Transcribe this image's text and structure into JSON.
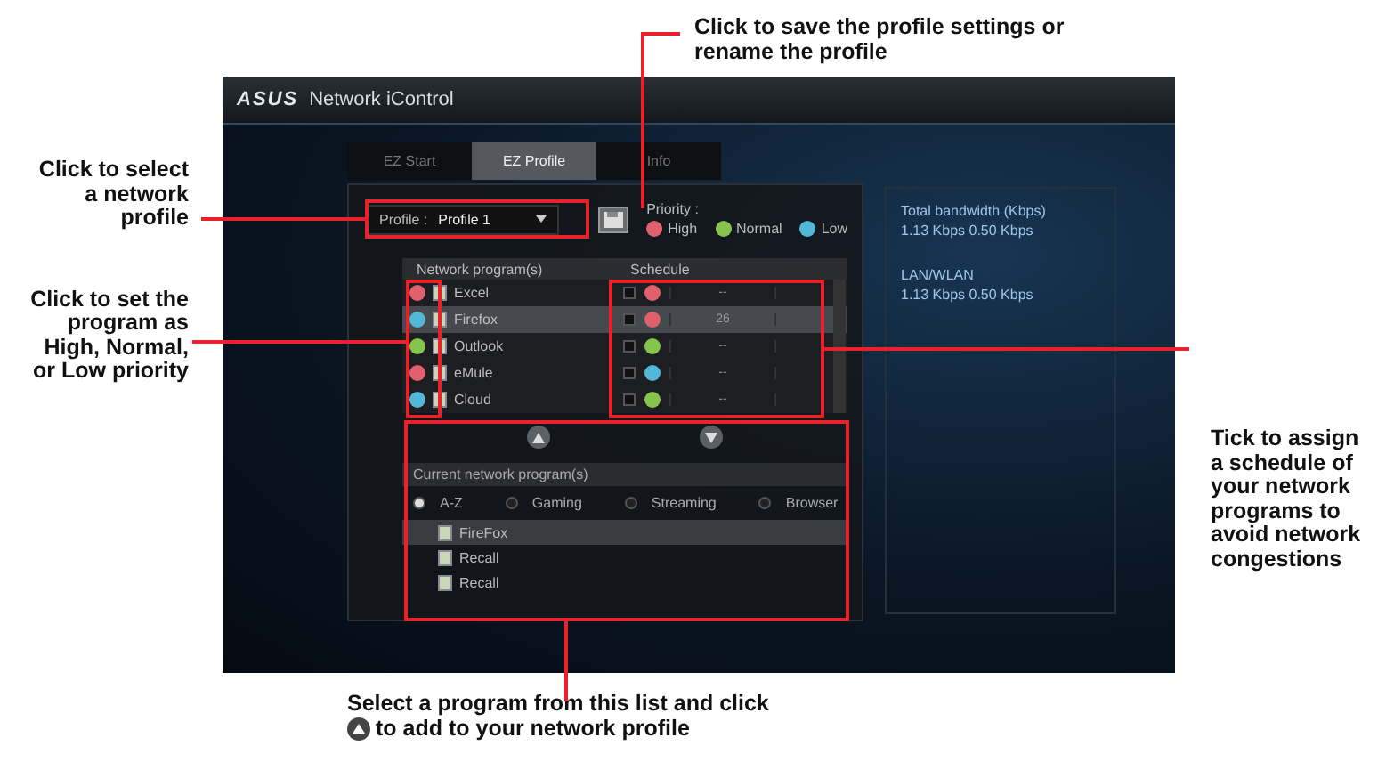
{
  "callouts": {
    "select_profile": [
      "Click to select",
      "a network",
      "profile"
    ],
    "set_priority": [
      "Click to set the",
      "program as",
      "High, Normal,",
      "or Low priority"
    ],
    "save_profile": [
      "Click to save the profile settings or",
      "rename the profile"
    ],
    "schedule": [
      "Tick to assign",
      "a schedule of",
      "your network",
      "programs to",
      "avoid network",
      "congestions"
    ],
    "add_program": {
      "first": "Select a program from this list and click",
      "second": "to add to your network profile"
    }
  },
  "window": {
    "logo": "ASUS",
    "title": "Network iControl"
  },
  "tabs": [
    {
      "label": "EZ Start",
      "selected": false
    },
    {
      "label": "EZ Profile",
      "selected": true
    },
    {
      "label": "Info",
      "selected": false
    }
  ],
  "profile": {
    "label": "Profile :",
    "value": "Profile 1"
  },
  "priority_legend": {
    "label": "Priority :",
    "levels": [
      {
        "label": "High",
        "color": "#e0606e"
      },
      {
        "label": "Normal",
        "color": "#86c44e"
      },
      {
        "label": "Low",
        "color": "#52b8d8"
      }
    ]
  },
  "programs_table": {
    "columns": [
      "Network program(s)",
      "Schedule"
    ],
    "rows": [
      {
        "name": "Excel",
        "selected": false,
        "color": "#e0606e",
        "schedule": {
          "checked": false,
          "color": "#e0606e",
          "time": "--"
        }
      },
      {
        "name": "Firefox",
        "selected": true,
        "color": "#52b8d8",
        "schedule": {
          "checked": false,
          "color": "#e0606e",
          "time": "26"
        }
      },
      {
        "name": "Outlook",
        "selected": false,
        "color": "#86c44e",
        "schedule": {
          "checked": false,
          "color": "#86c44e",
          "time": "--"
        }
      },
      {
        "name": "eMule",
        "selected": false,
        "color": "#e0606e",
        "schedule": {
          "checked": false,
          "color": "#52b8d8",
          "time": "--"
        }
      },
      {
        "name": "Cloud",
        "selected": false,
        "color": "#52b8d8",
        "schedule": {
          "checked": false,
          "color": "#86c44e",
          "time": "--"
        }
      }
    ]
  },
  "current_programs": {
    "title": "Current network program(s)",
    "filters": [
      {
        "label": "A-Z",
        "selected": true
      },
      {
        "label": "Gaming",
        "selected": false
      },
      {
        "label": "Streaming",
        "selected": false
      },
      {
        "label": "Browser",
        "selected": false
      }
    ],
    "items": [
      {
        "name": "FireFox",
        "selected": true
      },
      {
        "name": "Recall",
        "selected": false
      },
      {
        "name": "Recall",
        "selected": false
      }
    ]
  },
  "info_panel": [
    {
      "title": "Total bandwidth (Kbps)",
      "value": "1.13 Kbps  0.50 Kbps"
    },
    {
      "title": "LAN/WLAN",
      "value": "1.13 Kbps  0.50 Kbps"
    }
  ]
}
